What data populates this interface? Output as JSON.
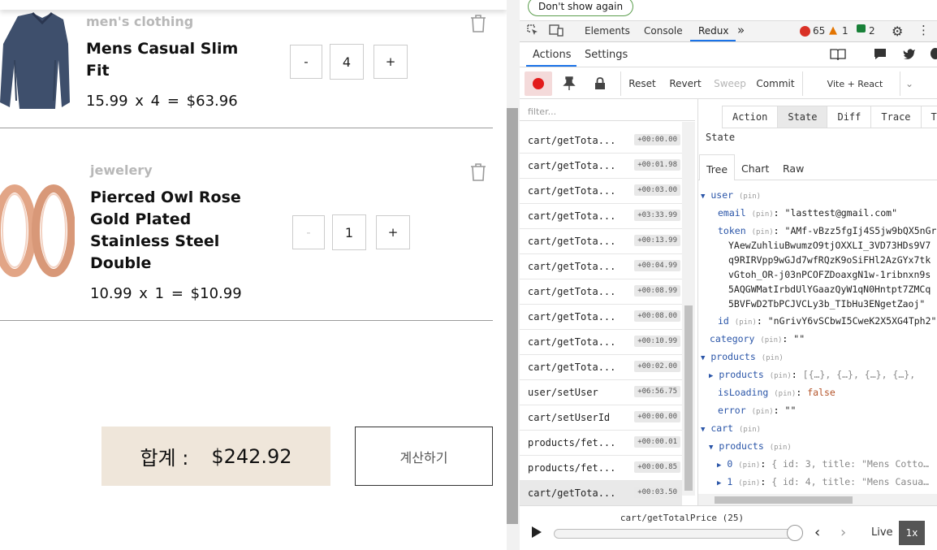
{
  "cart": {
    "items": [
      {
        "category": "men's clothing",
        "title_line1": "Mens Casual Slim",
        "title_line2": "Fit",
        "price": "15.99",
        "qty": "4",
        "line_total": "$63.96",
        "minus": "-",
        "plus": "+"
      },
      {
        "category": "jewelery",
        "title_line1": "Pierced Owl Rose",
        "title_line2": "Gold Plated",
        "title_line3": "Stainless Steel",
        "title_line4": "Double",
        "price": "10.99",
        "qty": "1",
        "line_total": "$10.99",
        "minus": "-",
        "plus": "+"
      }
    ],
    "times_sign": "x",
    "equals_sign": "=",
    "total_label": "합계 :",
    "total_value": "$242.92",
    "checkout_label": "계산하기"
  },
  "devtools": {
    "banner": "Don't show again",
    "tabs": [
      "Elements",
      "Console",
      "Redux"
    ],
    "more": "»",
    "errors": "65",
    "warnings": "1",
    "messages": "2",
    "redux_tabs": [
      "Actions",
      "Settings"
    ],
    "toolbar": {
      "reset": "Reset",
      "revert": "Revert",
      "sweep": "Sweep",
      "commit": "Commit",
      "instance": "Vite + React"
    },
    "filter_placeholder": "filter...",
    "actions": [
      {
        "name": "cart/getTota...",
        "time": "+00:00.00"
      },
      {
        "name": "cart/getTota...",
        "time": "+00:01.98"
      },
      {
        "name": "cart/getTota...",
        "time": "+00:03.00"
      },
      {
        "name": "cart/getTota...",
        "time": "+03:33.99"
      },
      {
        "name": "cart/getTota...",
        "time": "+00:13.99"
      },
      {
        "name": "cart/getTota...",
        "time": "+00:04.99"
      },
      {
        "name": "cart/getTota...",
        "time": "+00:08.99"
      },
      {
        "name": "cart/getTota...",
        "time": "+00:08.00"
      },
      {
        "name": "cart/getTota...",
        "time": "+00:10.99"
      },
      {
        "name": "cart/getTota...",
        "time": "+00:02.00"
      },
      {
        "name": "user/setUser",
        "time": "+06:56.75"
      },
      {
        "name": "cart/setUserId",
        "time": "+00:00.00"
      },
      {
        "name": "products/fet...",
        "time": "+00:00.01"
      },
      {
        "name": "products/fet...",
        "time": "+00:00.85"
      },
      {
        "name": "cart/getTota...",
        "time": "+00:03.50"
      }
    ],
    "inspector_tabs": [
      "Action",
      "State",
      "Diff",
      "Trace",
      "Test"
    ],
    "state_title": "State",
    "sub_tabs": [
      "Tree",
      "Chart",
      "Raw"
    ],
    "pin": "(pin)",
    "tree": {
      "user": "user",
      "email_key": "email",
      "email_val": "\"lasttest@gmail.com\"",
      "token_key": "token",
      "token_lines": [
        "\"AMf-vBzz5fgIj4S5jw9bQX5nGr",
        "YAewZuhliuBwumzO9tjOXXLI_3VD73HDs9V7",
        "q9RIRVpp9wGJd7wfRQzK9oSiFHl2AzGYx7tk",
        "vGtoh_OR-j03nPCOFZDoaxgN1w-1ribnxn9s",
        "5AQGWMatIrbdUlYGaazQyW1qN0Hntpt7ZMCq",
        "5BVFwD2TbPCJVCLy3b_TIbHu3ENgetZaoj\""
      ],
      "id_key": "id",
      "id_val": "\"nGrivY6vSCbwI5CweK2X5XG4Tph2\"",
      "category_key": "category",
      "category_val": "\"\"",
      "products_key": "products",
      "products_inner_key": "products",
      "products_inner_val": "[{…}, {…}, {…}, {…},",
      "isLoading_key": "isLoading",
      "isLoading_val": "false",
      "error_key": "error",
      "error_val": "\"\"",
      "cart_key": "cart",
      "cart_products_key": "products",
      "item0_key": "0",
      "item0_val": "{ id: 3, title: \"Mens Cotto…",
      "item1_key": "1",
      "item1_val": "{ id: 4, title: \"Mens Casua…"
    },
    "slider_label": "cart/getTotalPrice (25)",
    "slider_position": 0.995,
    "live": "Live",
    "speed": "1x"
  }
}
